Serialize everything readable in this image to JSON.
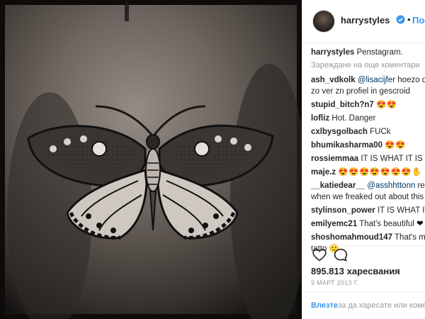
{
  "post": {
    "username": "harrystyles",
    "follow_label": "Последва",
    "caption_user": "harrystyles",
    "caption_text": "Penstagram.",
    "load_more": "Зареждане на още коментари",
    "likes": "895.813 харесвания",
    "date": "9 МАРТ 2013 Г.",
    "login_link": "Влезте",
    "login_rest": ", за да харесате или коментирате"
  },
  "comments": [
    {
      "user": "ash_vdkolk",
      "mention": "@lisacijfer",
      "text": " hoezo de fuck",
      "text2": "zo ver zn profiel in gescroid"
    },
    {
      "user": "stupid_bitch?n7",
      "text": "",
      "emoji": "😍😍"
    },
    {
      "user": "lofliz",
      "text": " Hot. Danger"
    },
    {
      "user": "cxlbysgolbach",
      "text": " FUCk"
    },
    {
      "user": "bhumikasharma00",
      "text": "",
      "emoji": "😍😍"
    },
    {
      "user": "rossiemmaa",
      "text": " IT IS WHAT IT IS"
    },
    {
      "user": "maje.z",
      "text": "",
      "emoji": "😍😍😍😍😍😍😍✋"
    },
    {
      "user": "__katiedear__",
      "mention": "@asshhttonn",
      "text": " remember",
      "text2": "when we freaked out about this"
    },
    {
      "user": "stylinson_power",
      "text": " IT IS WHAT IT IS"
    },
    {
      "user": "emilyemc21",
      "text": " That's beautiful ",
      "emoji": "❤"
    },
    {
      "user": "shoshomahmoud147",
      "text": " That's my favorite",
      "text2": "tatto 🙂"
    }
  ],
  "icons": {
    "verified": "verified-badge-icon",
    "heart": "heart-icon",
    "comment": "comment-icon"
  },
  "colors": {
    "link_blue": "#3897f0",
    "text": "#262626",
    "muted": "#999999"
  }
}
